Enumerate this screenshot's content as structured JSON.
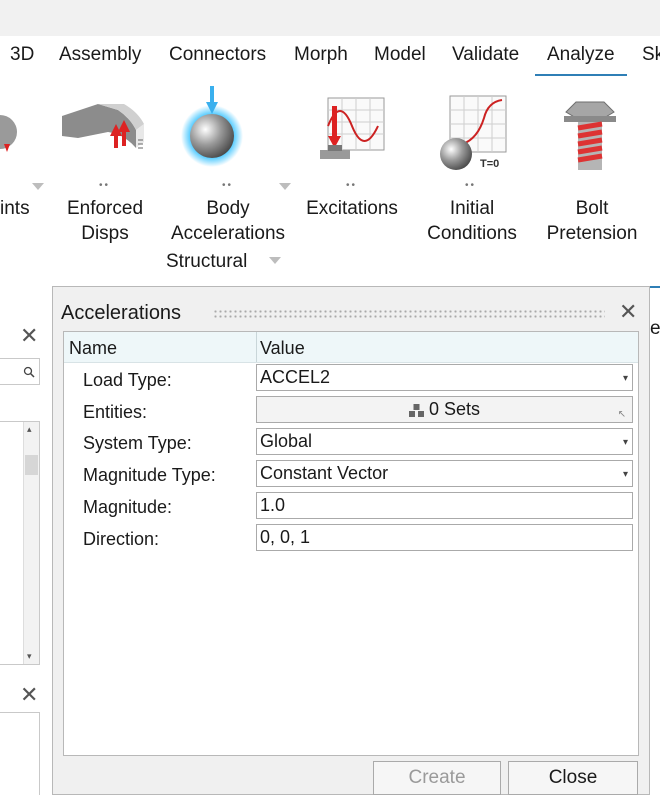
{
  "menubar": {
    "items": [
      "3D",
      "Assembly",
      "Connectors",
      "Morph",
      "Model",
      "Validate",
      "Analyze",
      "Sk"
    ],
    "active": "Analyze"
  },
  "ribbon": {
    "tools": [
      {
        "label": "ints",
        "icon": "constraints-icon"
      },
      {
        "label": "Enforced\nDisps",
        "icon": "enforced-displacements-icon"
      },
      {
        "label": "Body\nAccelerations",
        "icon": "body-accelerations-icon"
      },
      {
        "label": "Excitations",
        "icon": "excitations-icon"
      },
      {
        "label": "Initial\nConditions",
        "icon": "initial-conditions-icon"
      },
      {
        "label": "Bolt\nPretension",
        "icon": "bolt-pretension-icon"
      }
    ],
    "group_label": "Structural",
    "initial_conditions_badge": "T=0",
    "dots": "••",
    "edge_letter": "e"
  },
  "dialog": {
    "title": "Accelerations",
    "columns": {
      "name": "Name",
      "value": "Value"
    },
    "rows": [
      {
        "label": "Load Type:",
        "value": "ACCEL2",
        "kind": "dropdown"
      },
      {
        "label": "Entities:",
        "value": "0 Sets",
        "kind": "selector"
      },
      {
        "label": "System Type:",
        "value": "Global",
        "kind": "dropdown"
      },
      {
        "label": "Magnitude Type:",
        "value": "Constant Vector",
        "kind": "dropdown"
      },
      {
        "label": "Magnitude:",
        "value": "1.0",
        "kind": "text"
      },
      {
        "label": "Direction:",
        "value": "0, 0, 1",
        "kind": "text"
      }
    ],
    "buttons": {
      "create": "Create",
      "close": "Close"
    }
  },
  "colors": {
    "accent": "#2f7fb6",
    "grid_header": "#eef7f9",
    "dialog_bg": "#f0f0f0"
  }
}
